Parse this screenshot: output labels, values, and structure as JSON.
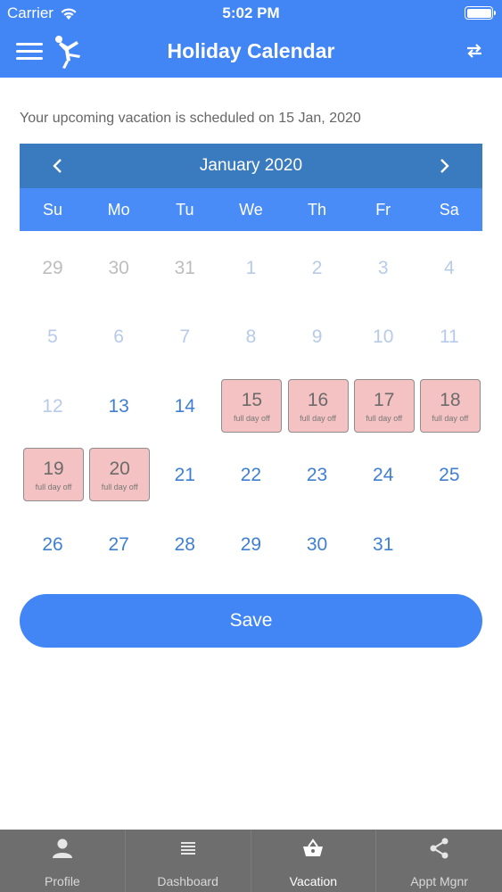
{
  "status": {
    "carrier": "Carrier",
    "time": "5:02 PM"
  },
  "nav": {
    "title": "Holiday Calendar"
  },
  "info": "Your upcoming vacation is scheduled on 15 Jan, 2020",
  "calendar": {
    "month_label": "January 2020",
    "weekdays": [
      "Su",
      "Mo",
      "Tu",
      "We",
      "Th",
      "Fr",
      "Sa"
    ],
    "off_label": "full day off",
    "days": [
      {
        "d": "29",
        "s": "other"
      },
      {
        "d": "30",
        "s": "other"
      },
      {
        "d": "31",
        "s": "other"
      },
      {
        "d": "1",
        "s": "past"
      },
      {
        "d": "2",
        "s": "past"
      },
      {
        "d": "3",
        "s": "past"
      },
      {
        "d": "4",
        "s": "past"
      },
      {
        "d": "5",
        "s": "past"
      },
      {
        "d": "6",
        "s": "past"
      },
      {
        "d": "7",
        "s": "past"
      },
      {
        "d": "8",
        "s": "past"
      },
      {
        "d": "9",
        "s": "past"
      },
      {
        "d": "10",
        "s": "past"
      },
      {
        "d": "11",
        "s": "past"
      },
      {
        "d": "12",
        "s": "past"
      },
      {
        "d": "13",
        "s": "cur"
      },
      {
        "d": "14",
        "s": "cur"
      },
      {
        "d": "15",
        "s": "off"
      },
      {
        "d": "16",
        "s": "off"
      },
      {
        "d": "17",
        "s": "off"
      },
      {
        "d": "18",
        "s": "off"
      },
      {
        "d": "19",
        "s": "off"
      },
      {
        "d": "20",
        "s": "off"
      },
      {
        "d": "21",
        "s": "cur"
      },
      {
        "d": "22",
        "s": "cur"
      },
      {
        "d": "23",
        "s": "cur"
      },
      {
        "d": "24",
        "s": "cur"
      },
      {
        "d": "25",
        "s": "cur"
      },
      {
        "d": "26",
        "s": "cur"
      },
      {
        "d": "27",
        "s": "cur"
      },
      {
        "d": "28",
        "s": "cur"
      },
      {
        "d": "29",
        "s": "cur"
      },
      {
        "d": "30",
        "s": "cur"
      },
      {
        "d": "31",
        "s": "cur"
      }
    ]
  },
  "save_label": "Save",
  "tabs": [
    {
      "label": "Profile",
      "icon": "person-icon"
    },
    {
      "label": "Dashboard",
      "icon": "list-icon"
    },
    {
      "label": "Vacation",
      "icon": "basket-icon",
      "active": true
    },
    {
      "label": "Appt Mgnr",
      "icon": "share-icon"
    }
  ],
  "colors": {
    "primary": "#4285f4",
    "calendar_header": "#3a7bbf",
    "off_day": "#f4c2c2",
    "tabbar": "#6e6e6e"
  }
}
